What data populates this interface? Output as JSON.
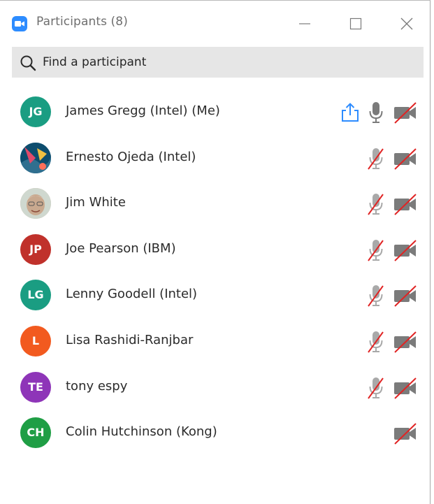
{
  "window": {
    "title": "Participants (8)"
  },
  "search": {
    "placeholder": "Find a participant"
  },
  "participants": [
    {
      "initials": "JG",
      "name": "James Gregg (Intel) (Me)",
      "avatar_color": "#1a9d82",
      "photo": null,
      "sharing": true,
      "mic": "on",
      "video": "off"
    },
    {
      "initials": "",
      "name": "Ernesto Ojeda (Intel)",
      "avatar_color": "#2f6f8f",
      "photo": "abstract",
      "sharing": false,
      "mic": "off",
      "video": "off"
    },
    {
      "initials": "",
      "name": "Jim White",
      "avatar_color": "#c9a98f",
      "photo": "face",
      "sharing": false,
      "mic": "off",
      "video": "off"
    },
    {
      "initials": "JP",
      "name": "Joe Pearson (IBM)",
      "avatar_color": "#c0312b",
      "photo": null,
      "sharing": false,
      "mic": "off",
      "video": "off"
    },
    {
      "initials": "LG",
      "name": "Lenny Goodell (Intel)",
      "avatar_color": "#1a9d82",
      "photo": null,
      "sharing": false,
      "mic": "off",
      "video": "off"
    },
    {
      "initials": "L",
      "name": "Lisa Rashidi-Ranjbar",
      "avatar_color": "#f25a1f",
      "photo": null,
      "sharing": false,
      "mic": "off",
      "video": "off"
    },
    {
      "initials": "TE",
      "name": "tony espy",
      "avatar_color": "#8e35b8",
      "photo": null,
      "sharing": false,
      "mic": "off",
      "video": "off"
    },
    {
      "initials": "CH",
      "name": "Colin Hutchinson (Kong)",
      "avatar_color": "#1f9e45",
      "photo": null,
      "sharing": false,
      "mic": "none",
      "video": "off"
    }
  ],
  "colors": {
    "accent": "#2d8cff",
    "icon_gray": "#7b7b7b",
    "muted_slash": "#e02424"
  },
  "icons": {
    "app": "zoom-camera-icon",
    "search": "search-icon",
    "share": "share-screen-icon",
    "mic": "microphone-icon",
    "mic_muted": "microphone-muted-icon",
    "video_off": "video-off-icon"
  }
}
